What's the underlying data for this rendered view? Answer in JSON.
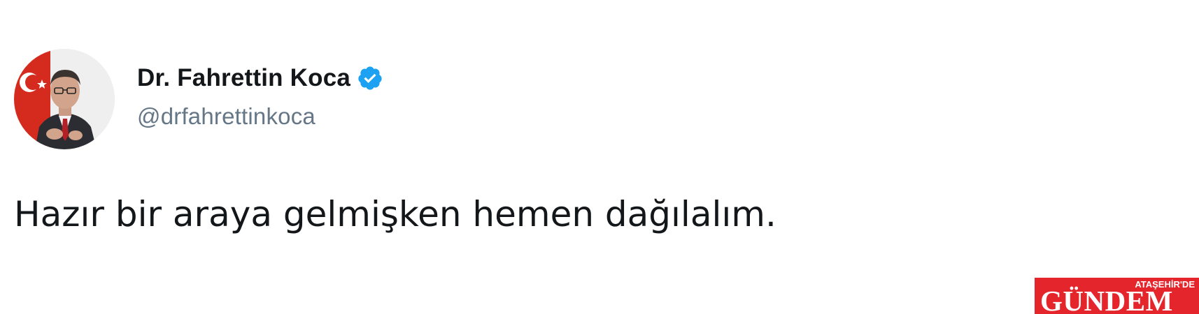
{
  "tweet": {
    "display_name": "Dr. Fahrettin Koca",
    "handle": "@drfahrettinkoca",
    "text": "Hazır bir araya gelmişken hemen dağılalım.",
    "verified": true,
    "avatar_icon": "profile-photo"
  },
  "watermark": {
    "line1": "ATAŞEHİR'DE",
    "line2": "GÜNDEM"
  },
  "colors": {
    "name": "#14171a",
    "handle": "#657786",
    "text": "#14171a",
    "verified": "#1da1f2",
    "watermark_bg": "#e4262c",
    "avatar_flag": "#d52b1e"
  }
}
